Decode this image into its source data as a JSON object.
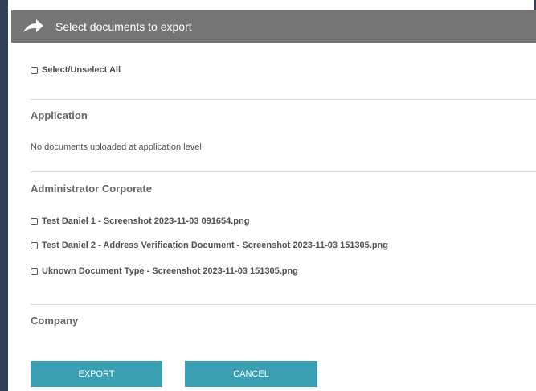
{
  "dialog": {
    "title": "Select documents to export",
    "icon": "forward-arrow-icon"
  },
  "select_all": {
    "label": "Select/Unselect All",
    "checked": false
  },
  "sections": {
    "application": {
      "title": "Application",
      "empty_message": "No documents uploaded at application level"
    },
    "administrator_corporate": {
      "title": "Administrator Corporate",
      "documents": [
        {
          "label": "Test Daniel 1 - Screenshot 2023-11-03 091654.png",
          "checked": false
        },
        {
          "label": "Test Daniel 2 - Address Verification Document - Screenshot 2023-11-03 151305.png",
          "checked": false
        },
        {
          "label": "Uknown Document Type - Screenshot 2023-11-03 151305.png",
          "checked": false
        }
      ]
    },
    "company": {
      "title": "Company"
    }
  },
  "buttons": {
    "export_label": "EXPORT",
    "cancel_label": "CANCEL"
  },
  "colors": {
    "header_bg": "#757575",
    "button_bg": "#3a9fb2",
    "side_rail": "#2e3f57"
  }
}
